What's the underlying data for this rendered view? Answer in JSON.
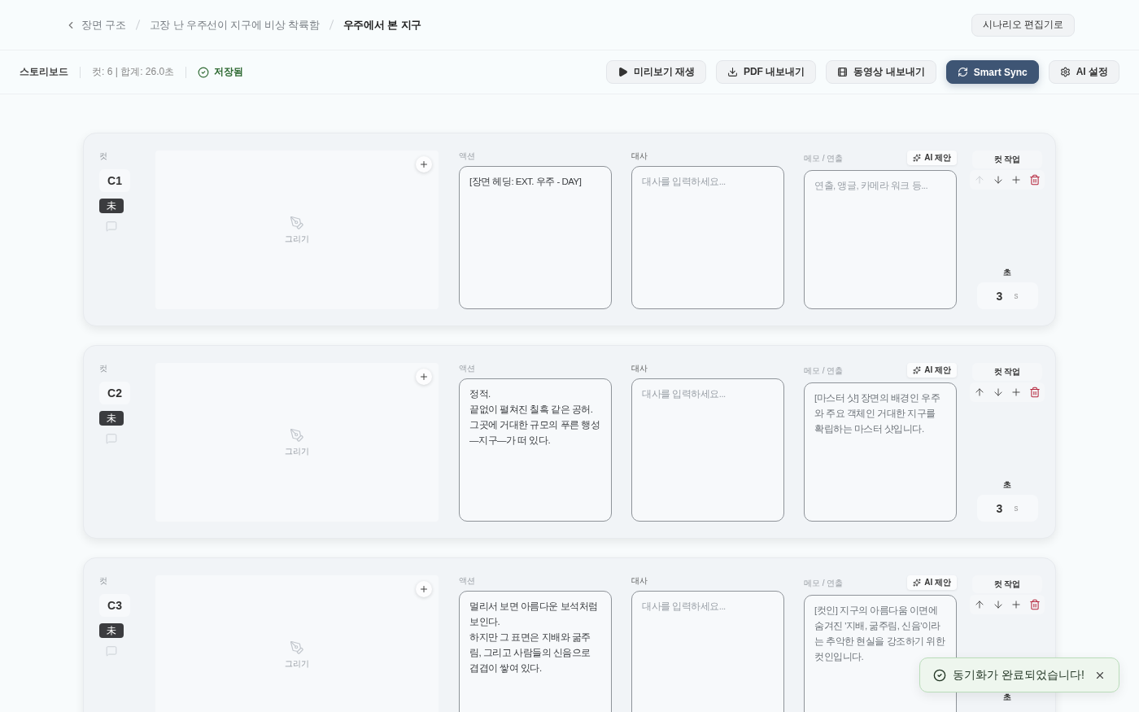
{
  "header": {
    "breadcrumb": [
      {
        "label": "장면 구조",
        "current": false
      },
      {
        "label": "고장 난 우주선이 지구에 비상 착륙함",
        "current": false
      },
      {
        "label": "우주에서 본 지구",
        "current": true
      }
    ],
    "editor_button": "시나리오 편집기로"
  },
  "toolbar": {
    "title": "스토리보드",
    "summary": "컷: 6 | 합계: 26.0초",
    "save_status": "저장됨",
    "buttons": [
      {
        "label": "미리보기 재생",
        "kind": "secondary"
      },
      {
        "label": "PDF 내보내기",
        "kind": "secondary"
      },
      {
        "label": "동영상 내보내기",
        "kind": "secondary"
      },
      {
        "label": "Smart Sync",
        "kind": "primary"
      },
      {
        "label": "AI 설정",
        "kind": "secondary"
      }
    ]
  },
  "cuts": [
    {
      "cut_label": "컷",
      "number": "C1",
      "status": "未",
      "drawing_label": "그리기",
      "fields": [
        {
          "kind": "text",
          "label": "액션",
          "active": false,
          "value": "[장면 헤딩: EXT. 우주 - DAY]"
        },
        {
          "kind": "text",
          "label": "대사",
          "active": true,
          "placeholder": "대사를 입력하세요..."
        },
        {
          "kind": "memo",
          "label": "메모 / 연출",
          "active": false,
          "placeholder": "연출, 앵글, 카메라 워크 등...",
          "ai_button": "AI 제안"
        }
      ],
      "tools_label": "컷 작업",
      "move_up_disabled": true,
      "duration_label": "초",
      "duration": "3",
      "duration_unit": "s"
    },
    {
      "cut_label": "컷",
      "number": "C2",
      "status": "未",
      "drawing_label": "그리기",
      "fields": [
        {
          "kind": "text",
          "label": "액션",
          "active": false,
          "value": "정적.\n끝없이 펼쳐진 칠흑 같은 공허.\n그곳에 거대한 규모의 푸른 행성—지구—가 떠 있다."
        },
        {
          "kind": "text",
          "label": "대사",
          "active": true,
          "placeholder": "대사를 입력하세요..."
        },
        {
          "kind": "memo",
          "label": "메모 / 연출",
          "active": false,
          "value": "[마스터 샷] 장면의 배경인 우주와 주요 객체인 거대한 지구를 확립하는 마스터 샷입니다.",
          "ai_button": "AI 제안"
        }
      ],
      "tools_label": "컷 작업",
      "move_up_disabled": false,
      "duration_label": "초",
      "duration": "3",
      "duration_unit": "s"
    },
    {
      "cut_label": "컷",
      "number": "C3",
      "status": "未",
      "drawing_label": "그리기",
      "fields": [
        {
          "kind": "text",
          "label": "액션",
          "active": false,
          "value": "멀리서 보면 아름다운 보석처럼 보인다.\n하지만 그 표면은 지배와 굶주림, 그리고 사람들의 신음으로 겹겹이 쌓여 있다."
        },
        {
          "kind": "text",
          "label": "대사",
          "active": true,
          "placeholder": "대사를 입력하세요..."
        },
        {
          "kind": "memo",
          "label": "메모 / 연출",
          "active": false,
          "value": "[컷인] 지구의 아름다움 이면에 숨겨진 '지배, 굶주림, 신음'이라는 추악한 현실을 강조하기 위한 컷인입니다.",
          "ai_button": "AI 제안"
        }
      ],
      "tools_label": "컷 작업",
      "move_up_disabled": false,
      "duration_label": "초"
    }
  ],
  "toast": {
    "message": "동기화가 완료되었습니다!"
  }
}
